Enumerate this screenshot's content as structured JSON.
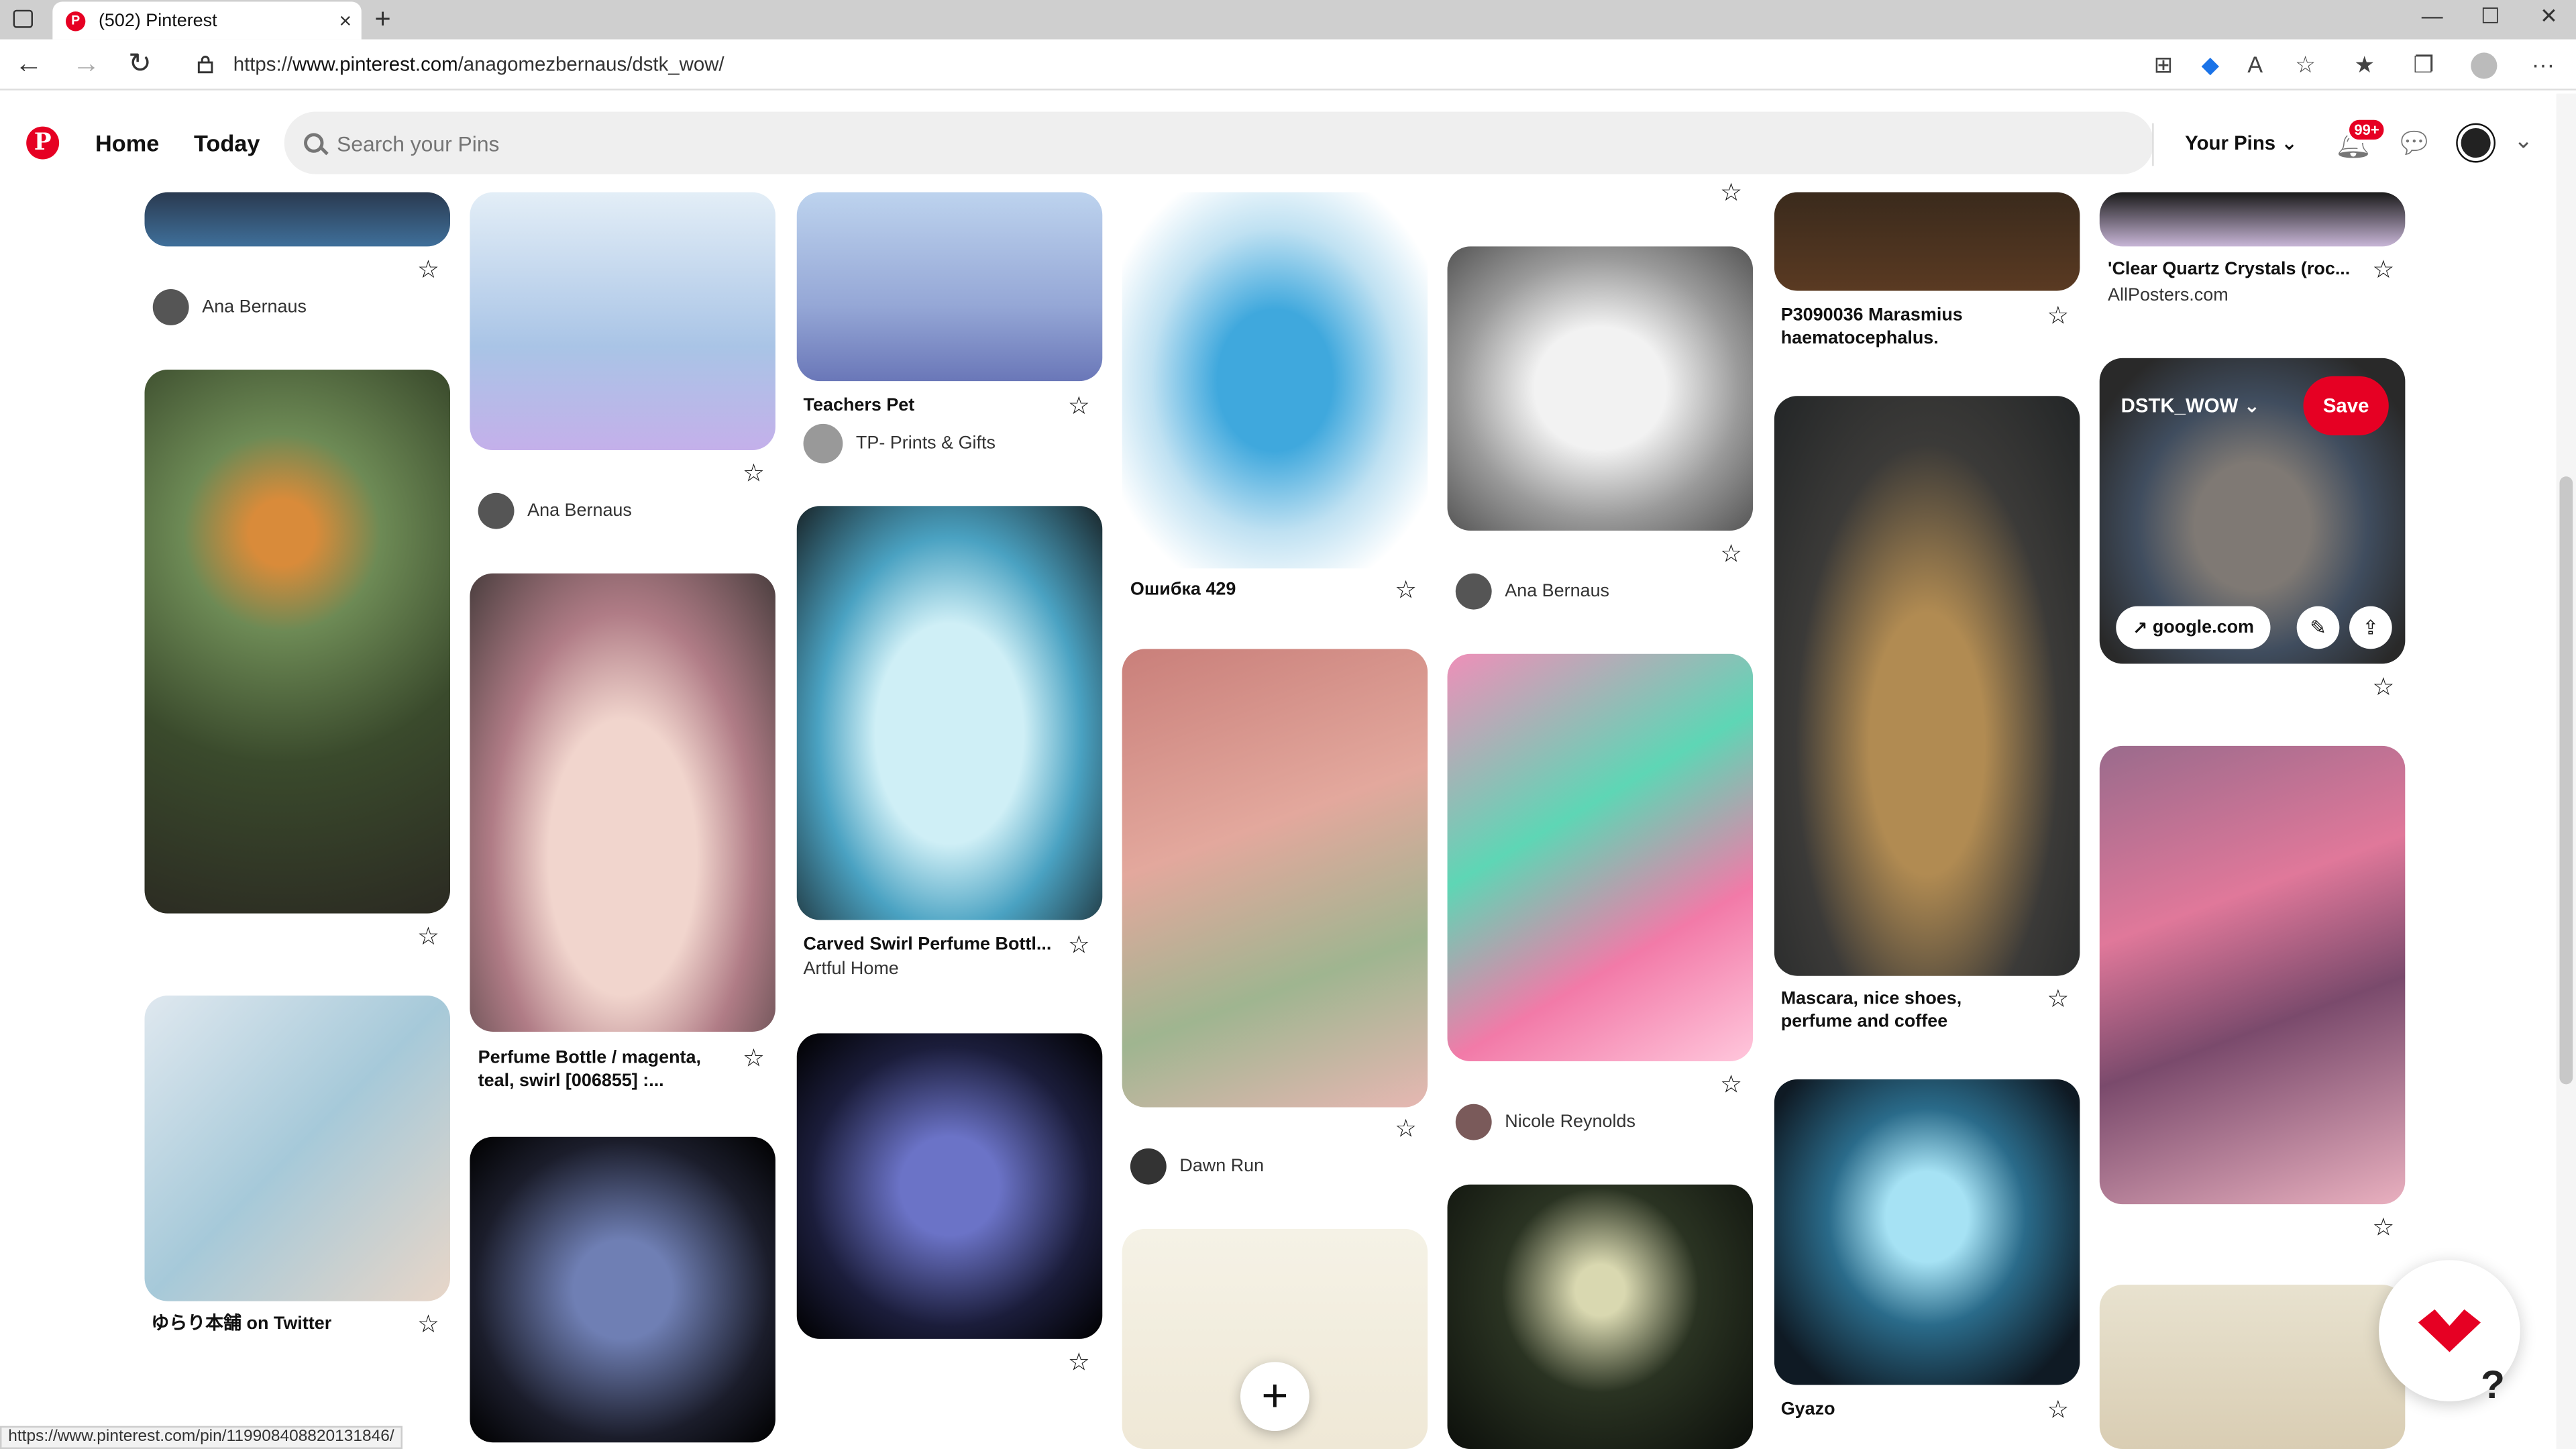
{
  "browser": {
    "tab_title": "(502) Pinterest",
    "tab_close": "×",
    "new_tab": "+",
    "url_prefix": "https://",
    "url_host": "www.pinterest.com",
    "url_path": "/anagomezbernaus/dstk_wow/",
    "status_url": "https://www.pinterest.com/pin/119908408820131846/"
  },
  "header": {
    "logo": "P",
    "nav_home": "Home",
    "nav_today": "Today",
    "search_placeholder": "Search your Pins",
    "your_pins": "Your Pins",
    "notif_badge": "99+"
  },
  "pins": {
    "c1_author1": "Ana Bernaus",
    "c1_title2": "ゆらり本舗 on Twitter",
    "c2_author1": "Ana Bernaus",
    "c2_title2": "Perfume Bottle / magenta, teal, swirl [006855] :...",
    "c3_title1": "Teachers Pet",
    "c3_sub1": "TP- Prints & Gifts",
    "c3_title2": "Carved Swirl Perfume Bottl...",
    "c3_sub2": "Artful Home",
    "c4_title1": "Ошибка 429",
    "c4_author2": "Dawn Run",
    "c5_author1": "Ana Bernaus",
    "c5_author2": "Nicole Reynolds",
    "c6_title1": "P3090036 Marasmius haematocephalus.",
    "c6_title2": "Mascara, nice shoes, perfume and coffee",
    "c6_title3": "Gyazo",
    "c7_title1": "'Clear Quartz Crystals (roc...",
    "c7_sub1": "AllPosters.com",
    "overlay_board": "DSTK_WOW",
    "overlay_save": "Save",
    "overlay_link": "google.com"
  },
  "icons": {
    "star": "☆",
    "plus": "+",
    "help": "?"
  }
}
